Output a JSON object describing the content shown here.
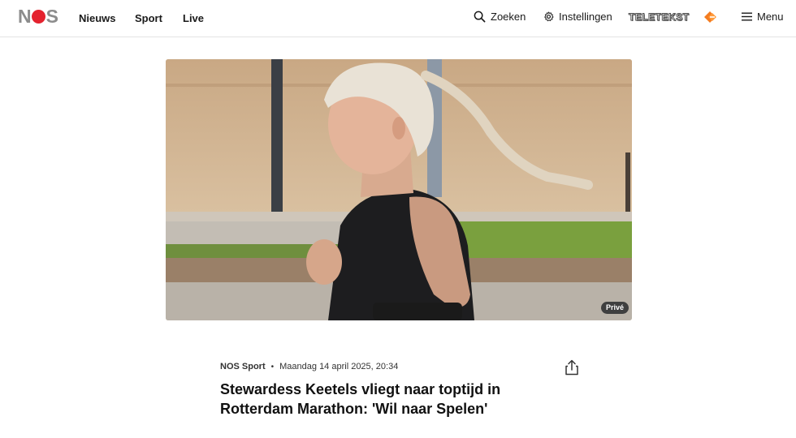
{
  "header": {
    "logo_text": {
      "left": "N",
      "right": "S"
    },
    "nav": [
      "Nieuws",
      "Sport",
      "Live"
    ],
    "search_label": "Zoeken",
    "settings_label": "Instellingen",
    "teletekst_label": "TELETEKST",
    "menu_label": "Menu"
  },
  "hero": {
    "badge": "Privé"
  },
  "article": {
    "source": "NOS Sport",
    "separator": "•",
    "date": "Maandag 14 april 2025, 20:34",
    "title": "Stewardess Keetels vliegt naar toptijd in Rotterdam Marathon: 'Wil naar Spelen'"
  }
}
